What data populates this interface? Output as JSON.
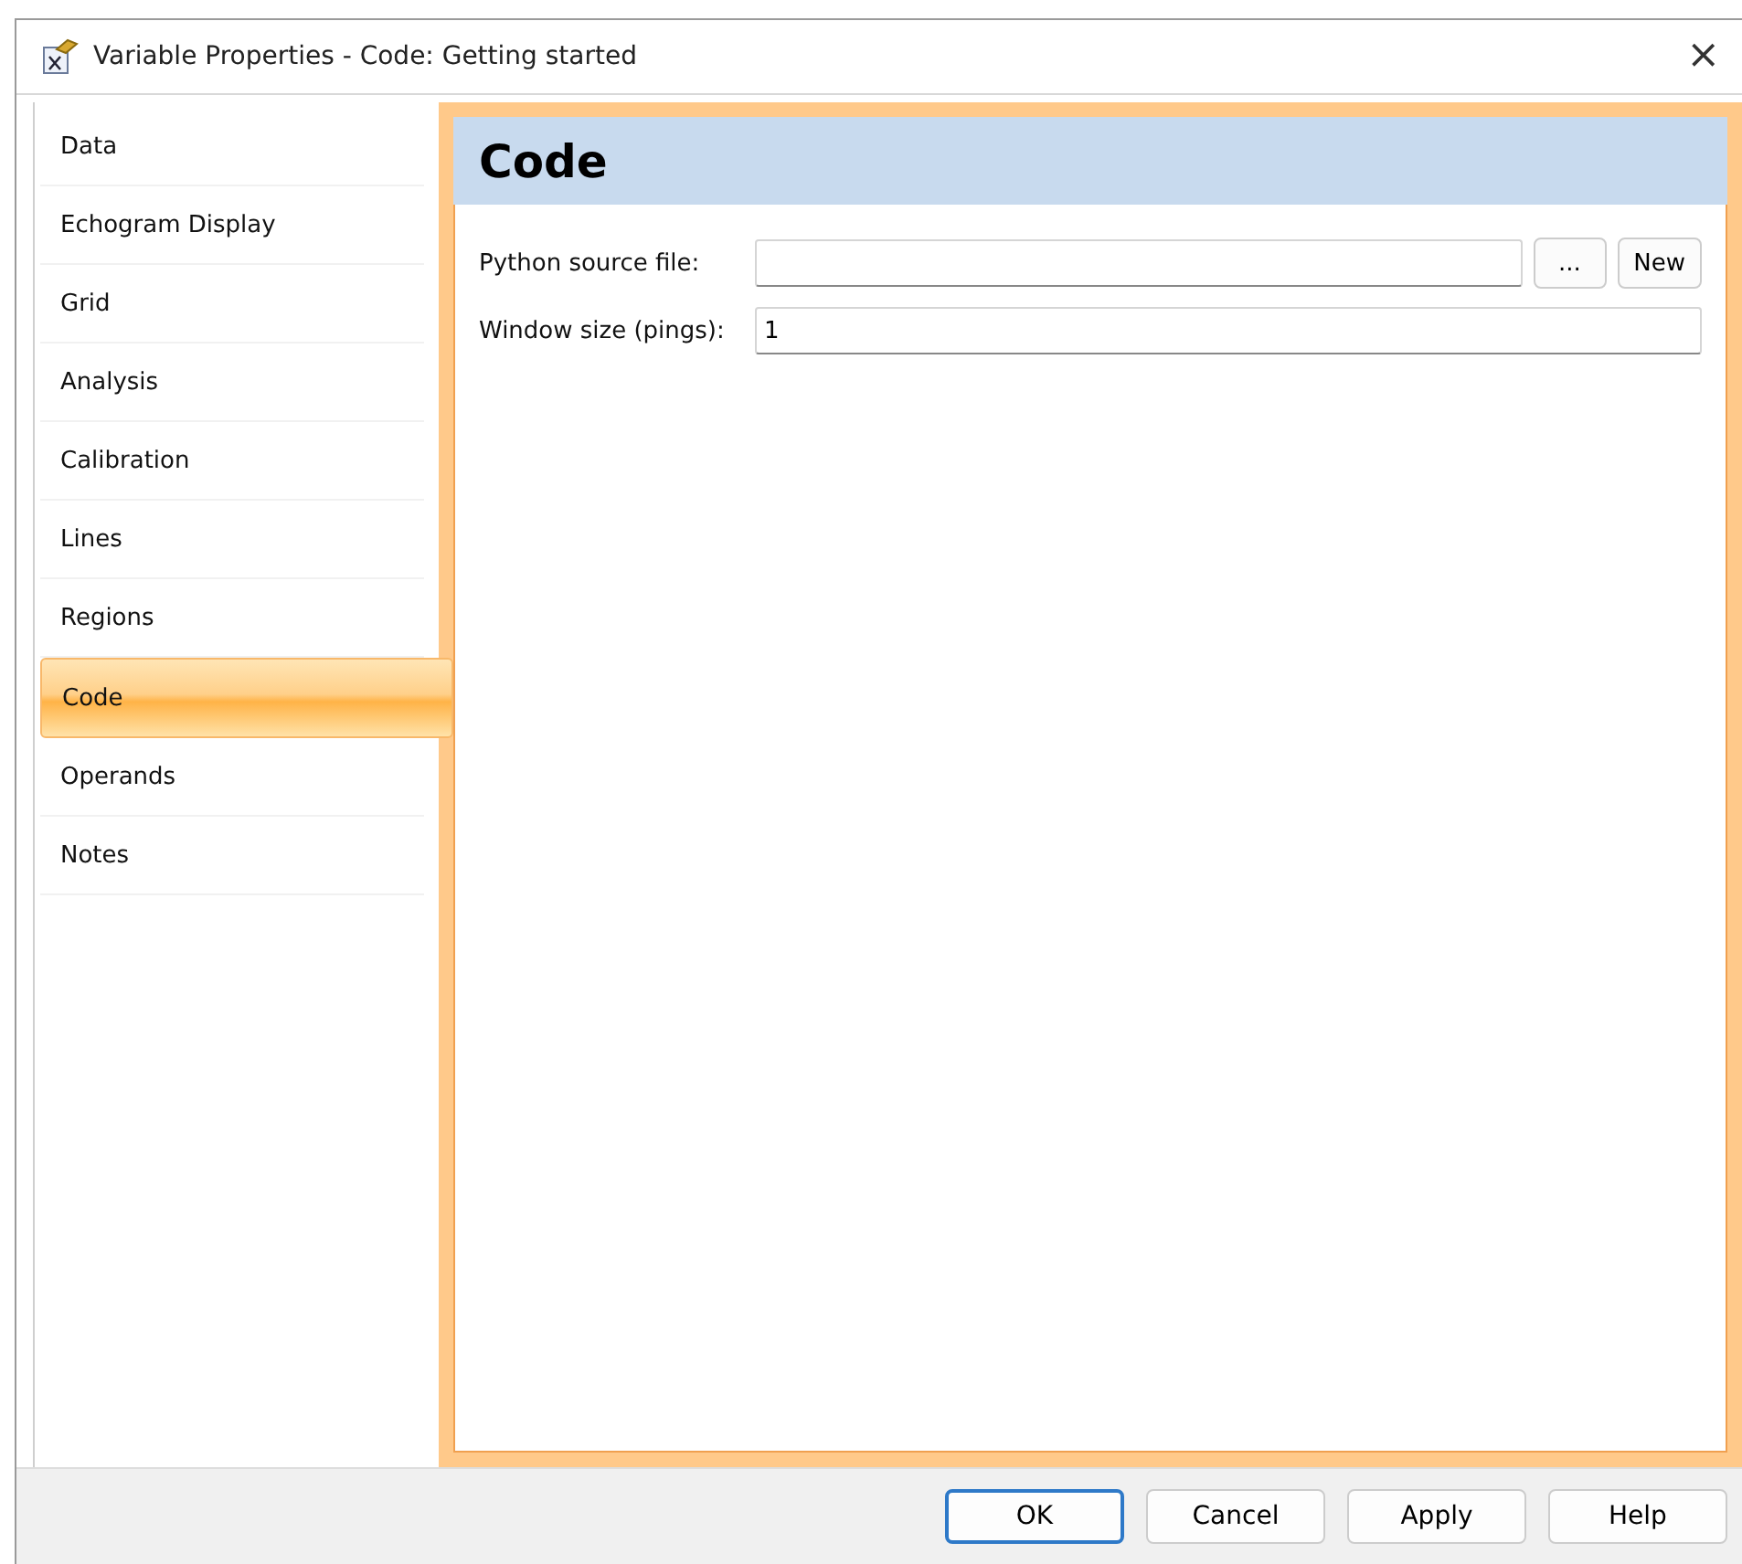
{
  "window": {
    "title": "Variable Properties - Code: Getting started",
    "close": "×"
  },
  "sidebar": {
    "items": [
      {
        "label": "Data",
        "selected": false
      },
      {
        "label": "Echogram Display",
        "selected": false
      },
      {
        "label": "Grid",
        "selected": false
      },
      {
        "label": "Analysis",
        "selected": false
      },
      {
        "label": "Calibration",
        "selected": false
      },
      {
        "label": "Lines",
        "selected": false
      },
      {
        "label": "Regions",
        "selected": false
      },
      {
        "label": "Code",
        "selected": true
      },
      {
        "label": "Operands",
        "selected": false
      },
      {
        "label": "Notes",
        "selected": false
      }
    ]
  },
  "panel": {
    "heading": "Code",
    "fields": [
      {
        "label": "Python source file:",
        "buttons": [
          "...",
          "New"
        ]
      },
      {
        "label": "Window size (pings):",
        "value": "1"
      }
    ]
  },
  "buttons": [
    {
      "label": "OK",
      "default": true
    },
    {
      "label": "Cancel",
      "default": false
    },
    {
      "label": "Apply",
      "default": false
    },
    {
      "label": "Help",
      "default": false
    }
  ]
}
